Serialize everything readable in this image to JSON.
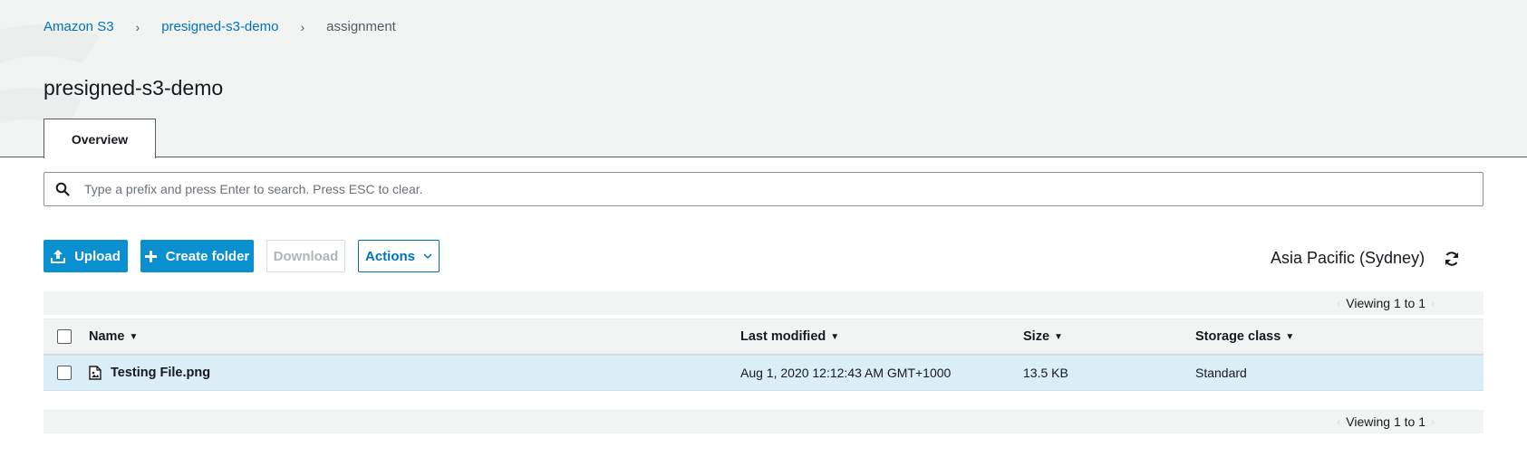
{
  "breadcrumb": {
    "items": [
      {
        "label": "Amazon S3"
      },
      {
        "label": "presigned-s3-demo"
      },
      {
        "label": "assignment"
      }
    ]
  },
  "page": {
    "title": "presigned-s3-demo"
  },
  "tabs": [
    {
      "label": "Overview",
      "active": true
    }
  ],
  "search": {
    "placeholder": "Type a prefix and press Enter to search. Press ESC to clear.",
    "value": ""
  },
  "toolbar": {
    "upload_label": "Upload",
    "create_folder_label": "Create folder",
    "download_label": "Download",
    "actions_label": "Actions",
    "region": "Asia Pacific (Sydney)"
  },
  "pagination": {
    "top_text": "Viewing 1 to 1",
    "bottom_text": "Viewing 1 to 1"
  },
  "table": {
    "columns": [
      {
        "label": "Name"
      },
      {
        "label": "Last modified"
      },
      {
        "label": "Size"
      },
      {
        "label": "Storage class"
      }
    ],
    "rows": [
      {
        "name": "Testing File.png",
        "last_modified": "Aug 1, 2020 12:12:43 AM GMT+1000",
        "size": "13.5 KB",
        "storage_class": "Standard",
        "selected": true
      }
    ]
  },
  "icons": {
    "search": "search-icon",
    "upload": "upload-icon",
    "create_folder": "plus-icon",
    "actions": "chevron-down-icon",
    "refresh": "refresh-icon",
    "file": "image-file-icon"
  },
  "colors": {
    "primary": "#0a8fd1",
    "link": "#0073bb",
    "header_band": "#f2f4f4",
    "selected_row": "#dbedf7"
  }
}
